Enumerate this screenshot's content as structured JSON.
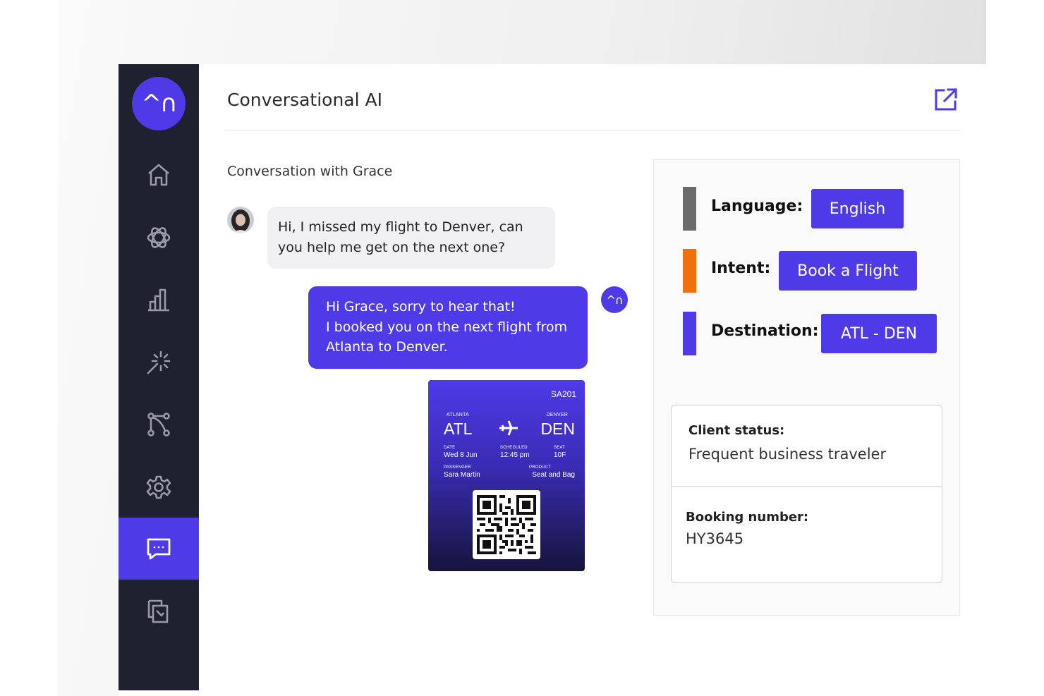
{
  "header": {
    "title": "Conversational AI"
  },
  "logo": {
    "text": "^∩"
  },
  "sidebar": {
    "items": [
      {
        "icon": "home-icon"
      },
      {
        "icon": "atom-icon"
      },
      {
        "icon": "bar-chart-icon"
      },
      {
        "icon": "magic-wand-icon"
      },
      {
        "icon": "flow-icon"
      },
      {
        "icon": "gear-icon"
      },
      {
        "icon": "chat-icon",
        "active": true
      },
      {
        "icon": "copy-icon"
      }
    ]
  },
  "conversation": {
    "heading": "Conversation with Grace",
    "user_message": "Hi, I missed my flight to Denver, can you help me get on the next one?",
    "bot_avatar": "^∩",
    "bot_message_lines": [
      "Hi Grace, sorry to hear that!",
      "I booked you on the next flight from",
      "Atlanta to Denver."
    ]
  },
  "boarding_pass": {
    "flight": "SA201",
    "from_city": "ATLANTA",
    "from_code": "ATL",
    "to_city": "DENVER",
    "to_code": "DEN",
    "date_label": "DATE",
    "date_value": "Wed 8 Jun",
    "scheduled_label": "SCHEDULED",
    "scheduled_value": "12:45 pm",
    "seat_label": "SEAT",
    "seat_value": "10F",
    "passenger_label": "PASSENGER",
    "passenger_value": "Sara Martin",
    "product_label": "PRODUCT",
    "product_value": "Seat and Bag"
  },
  "details": {
    "tags": [
      {
        "label": "Language:",
        "value": "English",
        "color": "#6b6b6b"
      },
      {
        "label": "Intent:",
        "value": "Book a Flight",
        "color": "#f0700e"
      },
      {
        "label": "Destination:",
        "value": "ATL - DEN",
        "color": "#4f3ae8"
      }
    ],
    "client_status_label": "Client status:",
    "client_status_value": "Frequent business traveler",
    "booking_label": "Booking number:",
    "booking_value": "HY3645"
  },
  "colors": {
    "accent": "#4f3ae8",
    "sidebar": "#1f2030"
  }
}
